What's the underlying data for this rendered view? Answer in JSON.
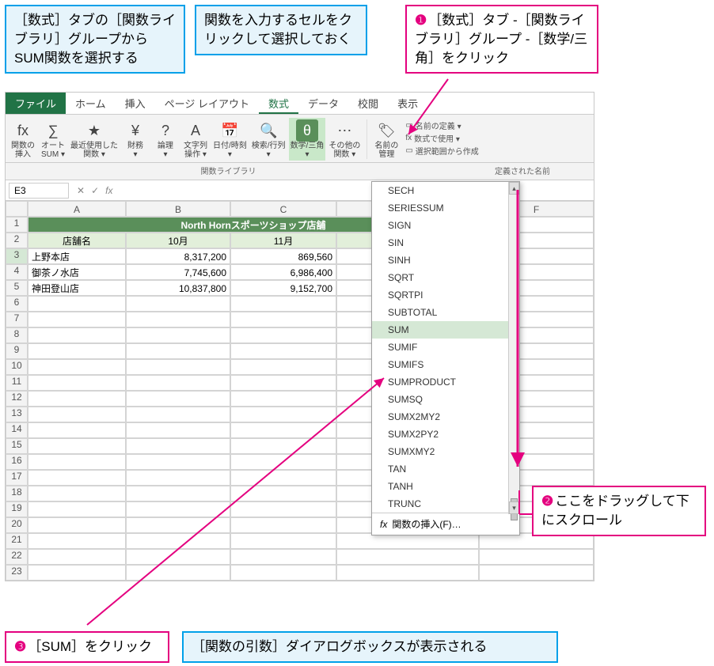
{
  "callouts": {
    "topLeft": "［数式］タブの［関数ライブラリ］グループからSUM関数を選択する",
    "topMid": "関数を入力するセルをクリックして選択しておく",
    "topRight1": "❶",
    "topRight": "［数式］タブ -［関数ライブラリ］グループ -［数学/三角］をクリック",
    "drag1": "❷",
    "drag": "ここをドラッグして下にスクロール",
    "sum1": "❸",
    "sum": "［SUM］をクリック",
    "bottom": "［関数の引数］ダイアログボックスが表示される"
  },
  "tabs": [
    "ファイル",
    "ホーム",
    "挿入",
    "ページ レイアウト",
    "数式",
    "データ",
    "校閲",
    "表示"
  ],
  "ribbon": {
    "items": [
      {
        "icon": "fx",
        "l1": "関数の",
        "l2": "挿入"
      },
      {
        "icon": "∑",
        "l1": "オート",
        "l2": "SUM ▾"
      },
      {
        "icon": "★",
        "l1": "最近使用した",
        "l2": "関数 ▾"
      },
      {
        "icon": "¥",
        "l1": "財務",
        "l2": "▾"
      },
      {
        "icon": "?",
        "l1": "論理",
        "l2": "▾"
      },
      {
        "icon": "A",
        "l1": "文字列",
        "l2": "操作 ▾"
      },
      {
        "icon": "📅",
        "l1": "日付/時刻",
        "l2": "▾"
      },
      {
        "icon": "🔍",
        "l1": "検索/行列",
        "l2": "▾"
      },
      {
        "icon": "θ",
        "l1": "数学/三角",
        "l2": "▾",
        "on": true
      },
      {
        "icon": "⋯",
        "l1": "その他の",
        "l2": "関数 ▾"
      },
      {
        "icon": "🏷",
        "l1": "名前の",
        "l2": "管理"
      }
    ],
    "group": "関数ライブラリ",
    "nameGroup": [
      "名前の定義 ▾",
      "数式で使用 ▾",
      "選択範囲から作成"
    ],
    "nameGroupTitle": "定義された名前"
  },
  "namebox": "E3",
  "columns": [
    "",
    "A",
    "B",
    "C",
    "D",
    "F"
  ],
  "rows": [
    {
      "n": "1",
      "cells": [
        {
          "v": "North Hornスポーツショップ店舗",
          "cls": "title-cell",
          "span": 4
        }
      ]
    },
    {
      "n": "2",
      "cells": [
        {
          "v": "店舗名",
          "cls": "hdr-cell"
        },
        {
          "v": "10月",
          "cls": "hdr-cell"
        },
        {
          "v": "11月",
          "cls": "hdr-cell"
        },
        {
          "v": "",
          "cls": "hdr-cell"
        }
      ]
    },
    {
      "n": "3",
      "cells": [
        {
          "v": "上野本店"
        },
        {
          "v": "8,317,200",
          "cls": "num"
        },
        {
          "v": "869,560",
          "cls": "num"
        },
        {
          "v": ""
        }
      ],
      "sel": true
    },
    {
      "n": "4",
      "cells": [
        {
          "v": "御茶ノ水店"
        },
        {
          "v": "7,745,600",
          "cls": "num"
        },
        {
          "v": "6,986,400",
          "cls": "num"
        },
        {
          "v": ""
        }
      ]
    },
    {
      "n": "5",
      "cells": [
        {
          "v": "神田登山店"
        },
        {
          "v": "10,837,800",
          "cls": "num"
        },
        {
          "v": "9,152,700",
          "cls": "num"
        },
        {
          "v": ""
        }
      ]
    }
  ],
  "emptyRows": [
    "6",
    "7",
    "8",
    "9",
    "10",
    "11",
    "12",
    "13",
    "14",
    "15",
    "16",
    "17",
    "18",
    "19",
    "20",
    "21",
    "22",
    "23"
  ],
  "dropdown": {
    "items": [
      "SECH",
      "SERIESSUM",
      "SIGN",
      "SIN",
      "SINH",
      "SQRT",
      "SQRTPI",
      "SUBTOTAL",
      "SUM",
      "SUMIF",
      "SUMIFS",
      "SUMPRODUCT",
      "SUMSQ",
      "SUMX2MY2",
      "SUMX2PY2",
      "SUMXMY2",
      "TAN",
      "TANH",
      "TRUNC"
    ],
    "highlight": "SUM",
    "footer": "関数の挿入(F)…",
    "fx": "fx"
  }
}
